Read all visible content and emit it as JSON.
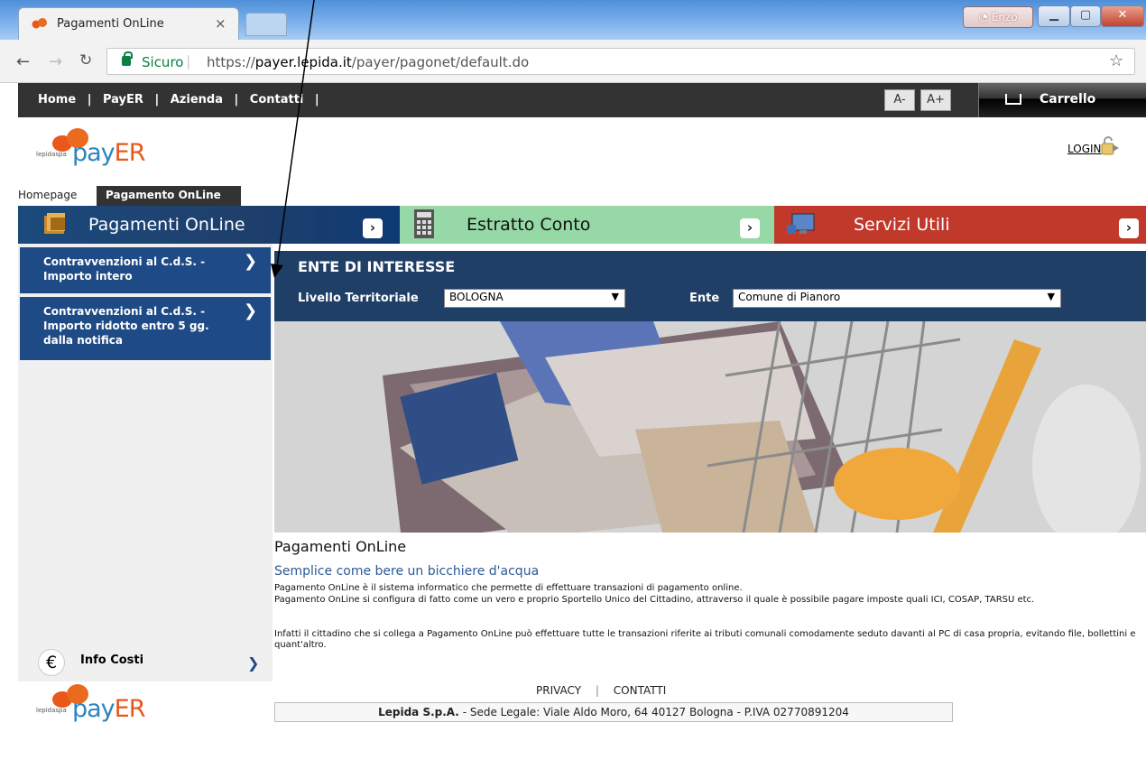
{
  "browser": {
    "tab_title": "Pagamenti OnLine",
    "tab_close": "×",
    "user_name": "Enzo",
    "secure_label": "Sicuro",
    "url_prefix": "https://",
    "url_host": "payer.lepida.it",
    "url_path": "/payer/pagonet/default.do"
  },
  "topnav": {
    "links": [
      "Home",
      "|",
      "PayER",
      "|",
      "Azienda",
      "|",
      "Contatti",
      "|"
    ],
    "font_decrease": "A-",
    "font_increase": "A+",
    "cart": "Carrello"
  },
  "header": {
    "logo_small": "lepidaspa",
    "logo_pay": "pay",
    "logo_er": "ER",
    "login": "LOGIN"
  },
  "breadcrumb": {
    "home": "Homepage",
    "current": "Pagamento OnLine"
  },
  "categories": [
    {
      "label": "Pagamenti OnLine",
      "color": "#1f3f6b"
    },
    {
      "label": "Estratto Conto",
      "color": "#96d9a6"
    },
    {
      "label": "Servizi Utili",
      "color": "#c0392b"
    }
  ],
  "left_menu": {
    "item1_line1": "Contravvenzioni al C.d.S. -",
    "item1_line2": "Importo intero",
    "item2_line1": "Contravvenzioni al C.d.S. -",
    "item2_line2": "Importo ridotto entro 5 gg.",
    "item2_line3": "dalla notifica",
    "info_costi": "Info Costi"
  },
  "ente": {
    "title": "ENTE DI INTERESSE",
    "livello_label": "Livello Territoriale",
    "livello_value": "BOLOGNA",
    "ente_label": "Ente",
    "ente_value": "Comune di Pianoro"
  },
  "content": {
    "title": "Pagamenti OnLine",
    "subtitle": "Semplice come bere un bicchiere d'acqua",
    "p1": "Pagamento OnLine è il sistema informatico che permette di effettuare transazioni di pagamento online.",
    "p2": "Pagamento OnLine si configura di fatto come un vero e proprio Sportello Unico del Cittadino, attraverso il quale è possibile pagare imposte quali ICI, COSAP, TARSU etc.",
    "p3": "Infatti il cittadino che si collega a Pagamento OnLine può effettuare tutte le transazioni riferite ai tributi comunali comodamente seduto davanti al PC di casa propria, evitando file, bollettini e quant'altro."
  },
  "footer": {
    "privacy": "PRIVACY",
    "sep": "|",
    "contatti": "CONTATTI",
    "company": "Lepida S.p.A.",
    "address": " - Sede Legale: Viale Aldo Moro, 64 40127 Bologna - P.IVA 02770891204"
  },
  "colors": {
    "accent_blue": "#1e4a85",
    "brand_orange": "#e9571a",
    "brand_blue": "#2d84bf"
  }
}
